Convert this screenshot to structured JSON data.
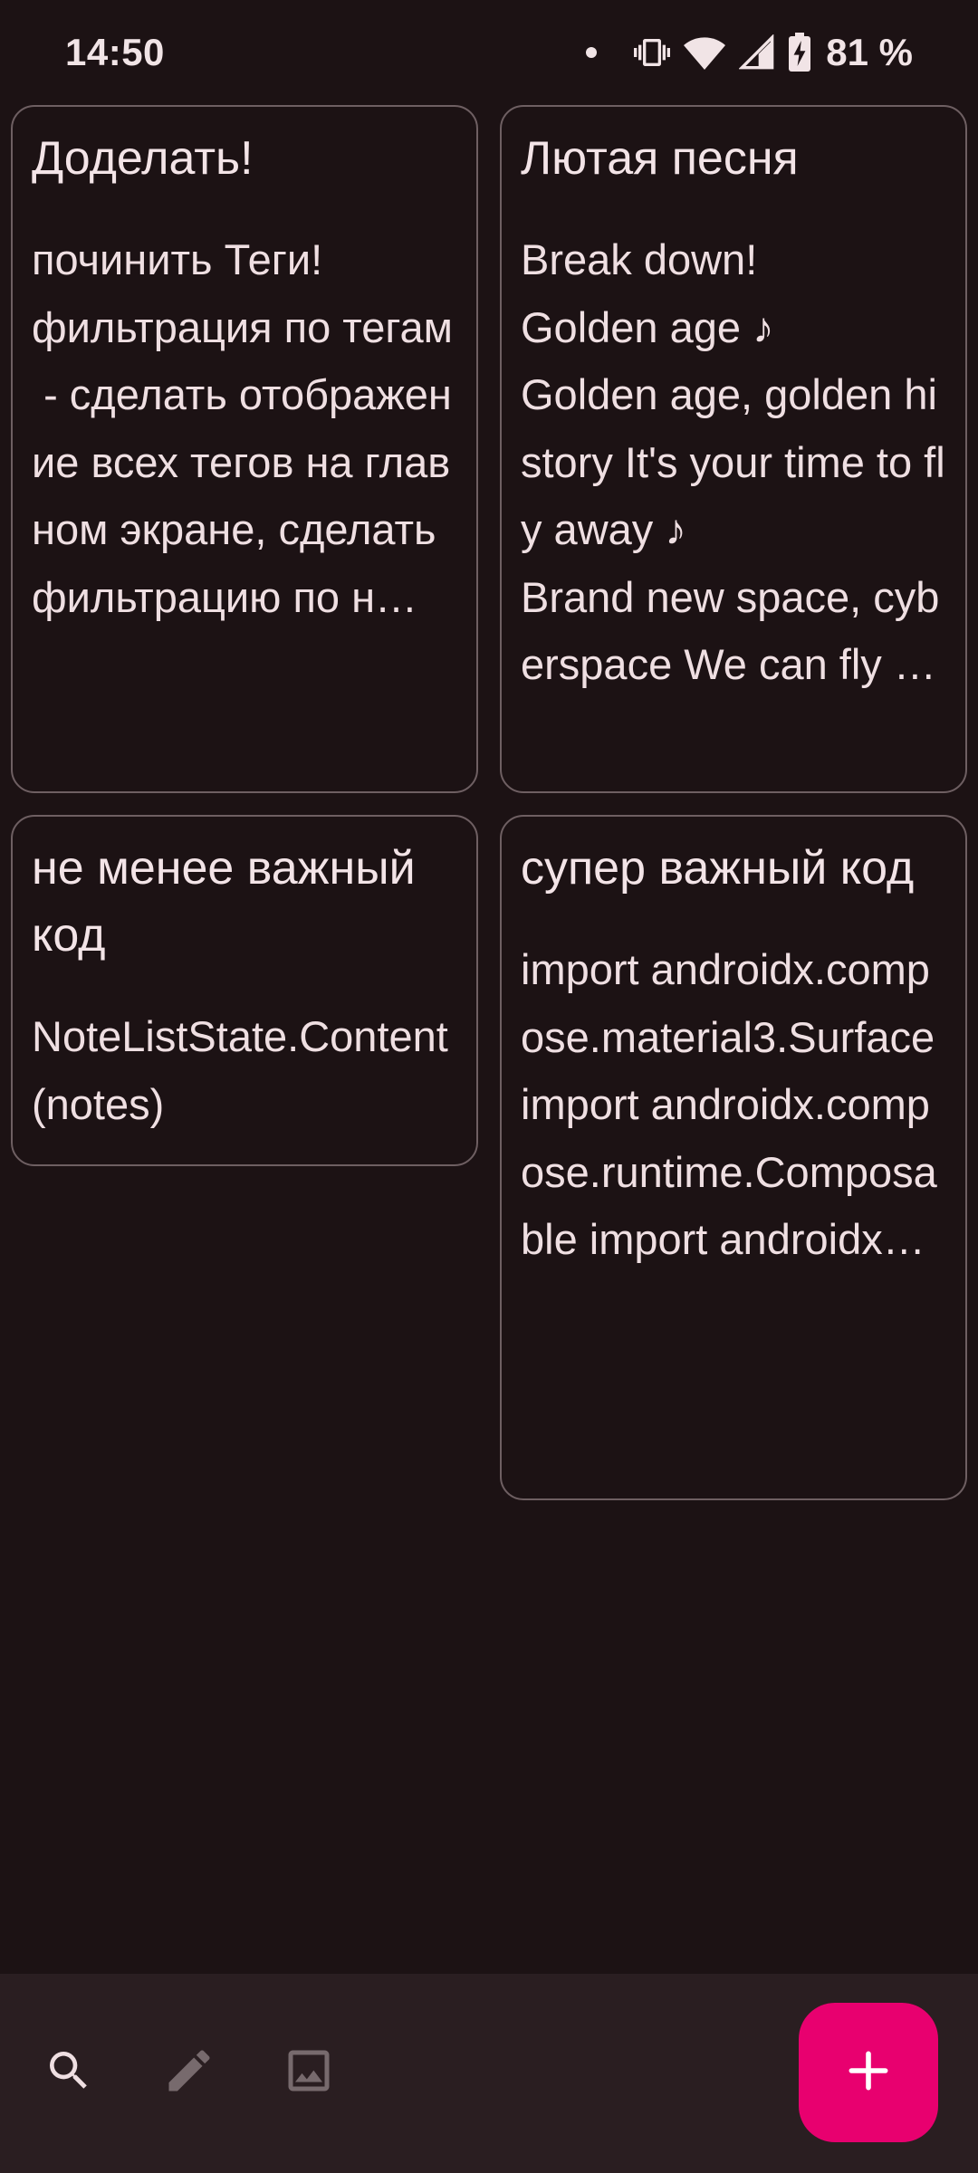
{
  "status_bar": {
    "time": "14:50",
    "battery_percent": "81 %"
  },
  "notes": [
    {
      "title": "Доделать!",
      "body": "починить Теги!\nфильтрация по тегам\n - сделать отображение всех тегов на главном экране, сделать фильтрацию по н…"
    },
    {
      "title": "Лютая песня",
      "body": "Break down!\nGolden age ♪\nGolden age, golden history It's your time to fly away ♪\nBrand new space, cyberspace We can fly through the ti…"
    },
    {
      "title": "не менее важный код",
      "body": "NoteListState.Content(notes)"
    },
    {
      "title": "супер важный код",
      "body": "import androidx.compose.material3.Surface import androidx.compose.runtime.Composable import androidx…"
    }
  ],
  "bottom_bar": {
    "icons": [
      "search-icon",
      "edit-icon",
      "image-icon"
    ],
    "fab_icon": "plus-icon"
  },
  "colors": {
    "background": "#1c1214",
    "card_border": "#6e5f62",
    "bottom_bar": "#2a1e21",
    "fab": "#e8006f",
    "text": "#efdfe2"
  }
}
